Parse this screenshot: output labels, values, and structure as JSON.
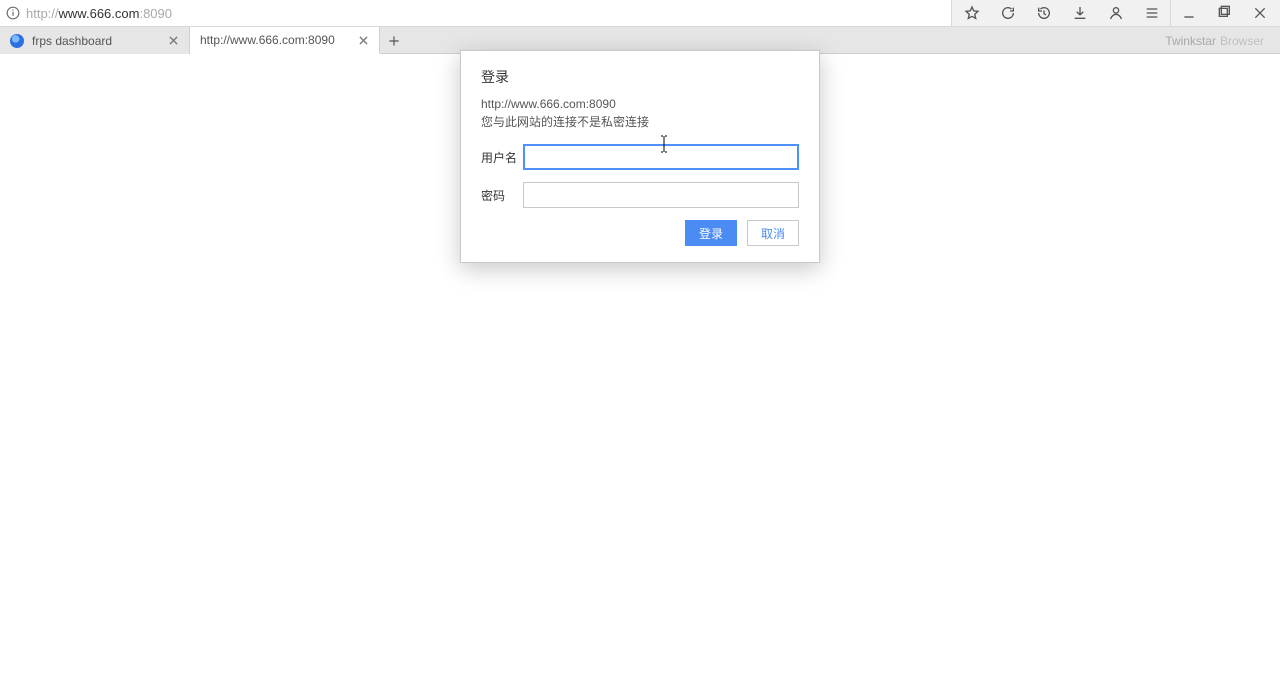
{
  "addressbar": {
    "scheme": "http://",
    "host": "www.666.com",
    "port": ":8090"
  },
  "tabs": [
    {
      "title": "frps dashboard",
      "active": false,
      "favicon": "frps"
    },
    {
      "title": "http://www.666.com:8090",
      "active": true,
      "favicon": "blank"
    }
  ],
  "browser_brand": {
    "name": "Twinkstar",
    "suffix": "Browser"
  },
  "toolbar_icons": {
    "star": "star-icon",
    "reload": "reload-icon",
    "history": "history-icon",
    "downloads": "download-icon",
    "account": "account-icon",
    "menu": "menu-icon",
    "minimize": "minimize-icon",
    "maximize": "maximize-icon",
    "close": "close-icon"
  },
  "dialog": {
    "title": "登录",
    "origin": "http://www.666.com:8090",
    "warning": "您与此网站的连接不是私密连接",
    "username_label": "用户名",
    "password_label": "密码",
    "username_value": "",
    "password_value": "",
    "login_label": "登录",
    "cancel_label": "取消"
  }
}
